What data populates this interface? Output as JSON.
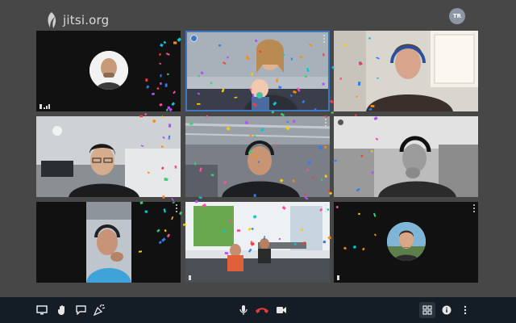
{
  "app": {
    "logo_text": "jitsi.org"
  },
  "user": {
    "initials": "TR"
  },
  "tiles": [
    {
      "id": "p1",
      "indicator": "signal-weak",
      "has_avatar": true
    },
    {
      "id": "p2",
      "active": true,
      "pinned": true
    },
    {
      "id": "p3"
    },
    {
      "id": "p4"
    },
    {
      "id": "p5"
    },
    {
      "id": "p6"
    },
    {
      "id": "p7"
    },
    {
      "id": "p8"
    },
    {
      "id": "p9",
      "has_avatar": true
    }
  ],
  "toolbar": {
    "left": [
      "screen-share-icon",
      "raise-hand-icon",
      "chat-icon",
      "confetti-icon"
    ],
    "center": [
      "microphone-icon",
      "hangup-icon",
      "camera-icon"
    ],
    "right": [
      "tile-view-icon",
      "info-icon",
      "more-options-icon"
    ],
    "hangup_color": "#e03b3b",
    "tile_view_active_bg": "#2a3441"
  },
  "colors": {
    "background": "#474747",
    "active_border": "#3c78c3",
    "toolbar_bg": "#141c26"
  }
}
